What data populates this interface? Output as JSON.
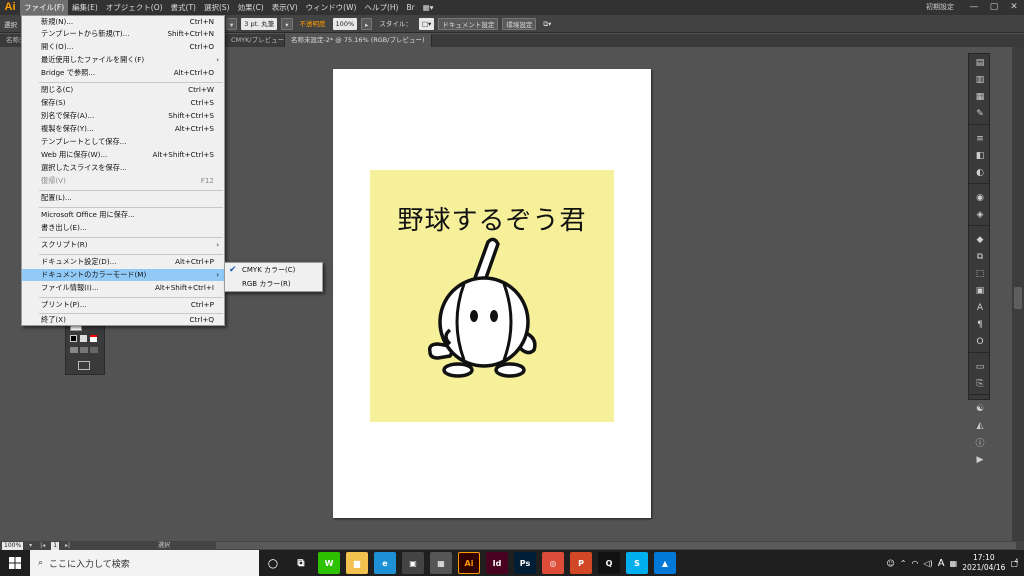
{
  "app": {
    "logo": "Ai",
    "workspace": "初期設定"
  },
  "menubar": {
    "items": [
      "ファイル(F)",
      "編集(E)",
      "オブジェクト(O)",
      "書式(T)",
      "選択(S)",
      "効果(C)",
      "表示(V)",
      "ウィンドウ(W)",
      "ヘルプ(H)"
    ]
  },
  "controlbar": {
    "stroke": "3 pt. 丸筆",
    "opacity_label": "不透明度",
    "opacity": "100%",
    "style_label": "スタイル：",
    "doc_setup": "ドキュメント設定",
    "prefs": "環境設定",
    "left_label": "選択"
  },
  "tabs": [
    "名称未",
    "CMYK/プレビュー",
    "名称未設定-2* @ 75.16% (RGB/プレビュー)"
  ],
  "canvas": {
    "title": "野球するぞう君",
    "accent": "#f6f09a"
  },
  "filemenu": {
    "items": [
      {
        "label": "新規(N)...",
        "shortcut": "Ctrl+N"
      },
      {
        "label": "テンプレートから新規(T)...",
        "shortcut": "Shift+Ctrl+N"
      },
      {
        "label": "開く(O)...",
        "shortcut": "Ctrl+O"
      },
      {
        "label": "最近使用したファイルを開く(F)",
        "shortcut": ""
      },
      {
        "label": "Bridge で参照...",
        "shortcut": "Alt+Ctrl+O"
      },
      {
        "label": "閉じる(C)",
        "shortcut": "Ctrl+W"
      },
      {
        "label": "保存(S)",
        "shortcut": "Ctrl+S"
      },
      {
        "label": "別名で保存(A)...",
        "shortcut": "Shift+Ctrl+S"
      },
      {
        "label": "複製を保存(Y)...",
        "shortcut": "Alt+Ctrl+S"
      },
      {
        "label": "テンプレートとして保存...",
        "shortcut": ""
      },
      {
        "label": "Web 用に保存(W)...",
        "shortcut": "Alt+Shift+Ctrl+S"
      },
      {
        "label": "選択したスライスを保存...",
        "shortcut": ""
      },
      {
        "label": "復帰(V)",
        "shortcut": "F12"
      },
      {
        "label": "配置(L)...",
        "shortcut": ""
      },
      {
        "label": "Microsoft Office 用に保存...",
        "shortcut": ""
      },
      {
        "label": "書き出し(E)...",
        "shortcut": ""
      },
      {
        "label": "スクリプト(R)",
        "shortcut": ""
      },
      {
        "label": "ドキュメント設定(D)...",
        "shortcut": "Alt+Ctrl+P"
      },
      {
        "label": "ドキュメントのカラーモード(M)",
        "shortcut": ""
      },
      {
        "label": "ファイル情報(I)...",
        "shortcut": "Alt+Shift+Ctrl+I"
      },
      {
        "label": "プリント(P)...",
        "shortcut": "Ctrl+P"
      },
      {
        "label": "終了(X)",
        "shortcut": "Ctrl+Q"
      }
    ]
  },
  "submenu": {
    "items": [
      "CMYK カラー(C)",
      "RGB カラー(R)"
    ]
  },
  "statusbar": {
    "zoom": "100%",
    "page": "1",
    "status": "選択"
  },
  "taskbar": {
    "search_placeholder": "ここに入力して検索",
    "time": "17:10",
    "date": "2021/04/16",
    "ime": "A",
    "notif_count": "4",
    "apps": [
      {
        "name": "wechat",
        "glyph": "W",
        "color": "#2dc100"
      },
      {
        "name": "explorer",
        "glyph": "▆",
        "color": "#f2c14e"
      },
      {
        "name": "edge",
        "glyph": "e",
        "color": "#1e90d6"
      },
      {
        "name": "store",
        "glyph": "▣",
        "color": "#444"
      },
      {
        "name": "calculator",
        "glyph": "▦",
        "color": "#555"
      },
      {
        "name": "illustrator",
        "glyph": "Ai",
        "color": "#330000"
      },
      {
        "name": "indesign",
        "glyph": "Id",
        "color": "#49021f"
      },
      {
        "name": "photoshop",
        "glyph": "Ps",
        "color": "#001e36"
      },
      {
        "name": "chrome",
        "glyph": "◎",
        "color": "#dd4b39"
      },
      {
        "name": "powerpoint",
        "glyph": "P",
        "color": "#d24726"
      },
      {
        "name": "qq",
        "glyph": "Q",
        "color": "#111"
      },
      {
        "name": "skype",
        "glyph": "S",
        "color": "#00aff0"
      },
      {
        "name": "photos",
        "glyph": "▲",
        "color": "#0078d7"
      }
    ]
  }
}
